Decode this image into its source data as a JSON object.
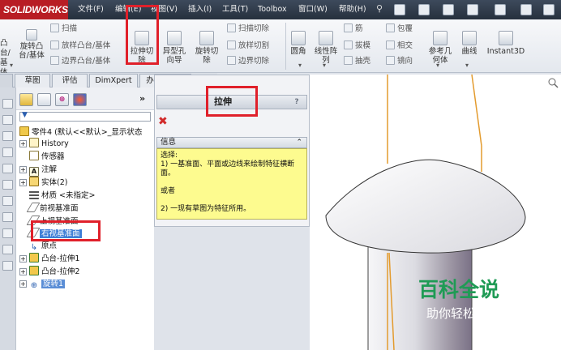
{
  "app": {
    "logo": "SOLIDWORKS"
  },
  "menu": {
    "items": [
      "文件(F)",
      "编辑(E)",
      "视图(V)",
      "插入(I)",
      "工具(T)",
      "Toolbox",
      "窗口(W)",
      "帮助(H)"
    ]
  },
  "ribbon": {
    "left_cut": {
      "a": "凸台/基体",
      "b": "旋转凸",
      "c": "台/基体"
    },
    "sweep": "扫描",
    "loft": "放样凸台/基体",
    "boundary": "边界凸台/基体",
    "extrude_cut": "拉伸切除",
    "hole_wizard": "异型孔向导",
    "revolve_cut": "旋转切除",
    "swept_cut": "扫描切除",
    "lofted_cut": "放样切割",
    "boundary_cut": "边界切除",
    "fillet": "圆角",
    "linear_pattern": "线性阵列",
    "rib": "筋",
    "draft": "拔模",
    "shell": "抽壳",
    "wrap": "包覆",
    "intersect": "相交",
    "mirror": "镜向",
    "ref_geometry": "参考几何体",
    "curves": "曲线",
    "instant3d": "Instant3D"
  },
  "tabs": {
    "items": [
      "草图",
      "评估",
      "DimXpert",
      "办公室产品"
    ]
  },
  "feature_tree": {
    "filter_icon": "funnel-icon",
    "root": "零件4 (默认<<默认>_显示状态",
    "items": [
      "History",
      "传感器",
      "注解",
      "实体(2)",
      "材质 <未指定>",
      "前视基准面",
      "上视基准面",
      "右视基准面",
      "原点",
      "凸台-拉伸1",
      "凸台-拉伸2",
      "旋转1"
    ]
  },
  "property_manager": {
    "title": "拉伸",
    "help": "?",
    "close_icon": "close-x-icon",
    "info_header": "信息",
    "info_lines": [
      "选择:",
      "1) 一基准面、平面或边线来绘制特征横断面。",
      "或者",
      "2) 一现有草图为特征所用。"
    ]
  },
  "watermark": {
    "title": "百科全说",
    "subtitle": "助你轻松解决"
  },
  "colors": {
    "highlight": "#e0202a",
    "selection": "#3f7fd6",
    "info_bg": "#fdfb8f",
    "edge_orange": "#e39b2e",
    "watermark_green": "#1f9b55"
  }
}
